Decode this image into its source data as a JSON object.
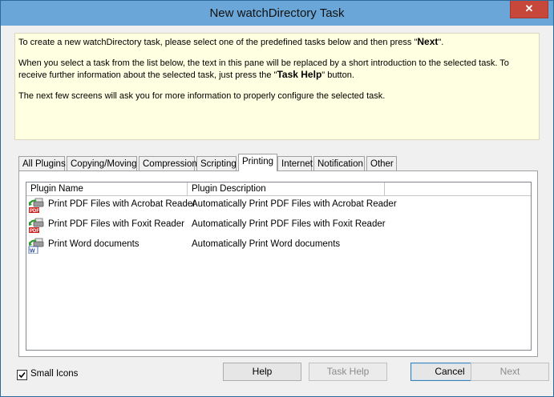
{
  "window": {
    "title": "New watchDirectory Task",
    "close_label": "✕"
  },
  "intro": {
    "p1_text": "To create a new watchDirectory task, please select one of the predefined tasks below and then press \"",
    "p1_key": "Next",
    "p1_end": "\".",
    "p2_text": "When you select a task from the list below, the text in this pane will be replaced by a short introduction to the selected task. To receive further information about the selected task, just press the \"",
    "p2_key": "Task Help",
    "p2_end": "\" button.",
    "p3_text": "The next few screens will ask you for more information to properly configure the selected task."
  },
  "tabs": [
    "All Plugins",
    "Copying/Moving",
    "Compression",
    "Scripting",
    "Printing",
    "Internet",
    "Notification",
    "Other"
  ],
  "active_tab": "Printing",
  "list": {
    "headers": [
      "Plugin Name",
      "Plugin Description"
    ],
    "rows": [
      {
        "name": "Print PDF Files with Acrobat Reader",
        "desc": "Automatically Print PDF Files with Acrobat Reader",
        "icon": "pdf-print-icon"
      },
      {
        "name": "Print PDF Files with Foxit Reader",
        "desc": "Automatically Print PDF Files with Foxit Reader",
        "icon": "pdf-print-icon"
      },
      {
        "name": "Print Word documents",
        "desc": "Automatically Print Word documents",
        "icon": "word-print-icon"
      }
    ]
  },
  "small_icons": {
    "label": "Small Icons",
    "checked": true
  },
  "buttons": {
    "help": "Help",
    "task_help": "Task Help",
    "cancel": "Cancel",
    "next": "Next"
  }
}
